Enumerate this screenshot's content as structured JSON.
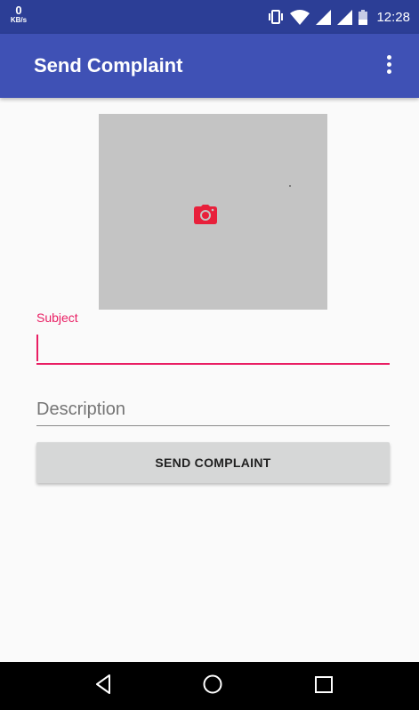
{
  "status_bar": {
    "speed_value": "0",
    "speed_unit": "KB/s",
    "time": "12:28",
    "icons": [
      "vibrate-icon",
      "wifi-icon",
      "signal-icon",
      "signal-icon",
      "battery-icon"
    ],
    "background": "#2c3e96"
  },
  "app_bar": {
    "title": "Send Complaint",
    "menu_icon": "more-vert-icon",
    "background": "#3f51b5"
  },
  "photo": {
    "icon": "camera-icon",
    "icon_color": "#e8203b",
    "background": "#c4c4c4"
  },
  "form": {
    "subject_label": "Subject",
    "subject_value": "",
    "description_placeholder": "Description",
    "description_value": "",
    "accent_color": "#e91e63",
    "send_label": "SEND COMPLAINT"
  },
  "nav_bar": {
    "icons": [
      "back-icon",
      "home-icon",
      "recents-icon"
    ]
  }
}
